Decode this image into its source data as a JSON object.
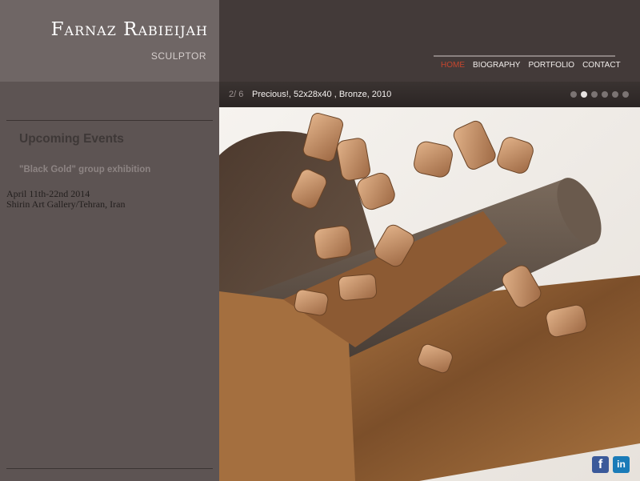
{
  "site": {
    "name": "Farnaz Rabieijah",
    "subtitle": "SCULPTOR"
  },
  "nav": {
    "items": [
      {
        "label": "HOME",
        "active": true
      },
      {
        "label": "BIOGRAPHY",
        "active": false
      },
      {
        "label": "PORTFOLIO",
        "active": false
      },
      {
        "label": "CONTACT",
        "active": false
      }
    ]
  },
  "events": {
    "heading": "Upcoming Events",
    "name": "\"Black Gold\" group exhibition",
    "date": "April 11th-22nd 2014",
    "place": "Shirin Art Gallery/Tehran, Iran"
  },
  "slideshow": {
    "counter": "2/ 6",
    "caption": "Precious!, 52x28x40 , Bronze, 2010",
    "total_slides": 6,
    "active_slide": 2
  },
  "social": {
    "facebook_icon": "f",
    "linkedin_icon": "in"
  },
  "colors": {
    "accent_active_nav": "#c6462e",
    "facebook": "#3b5a9a",
    "linkedin": "#1a7bb8"
  }
}
